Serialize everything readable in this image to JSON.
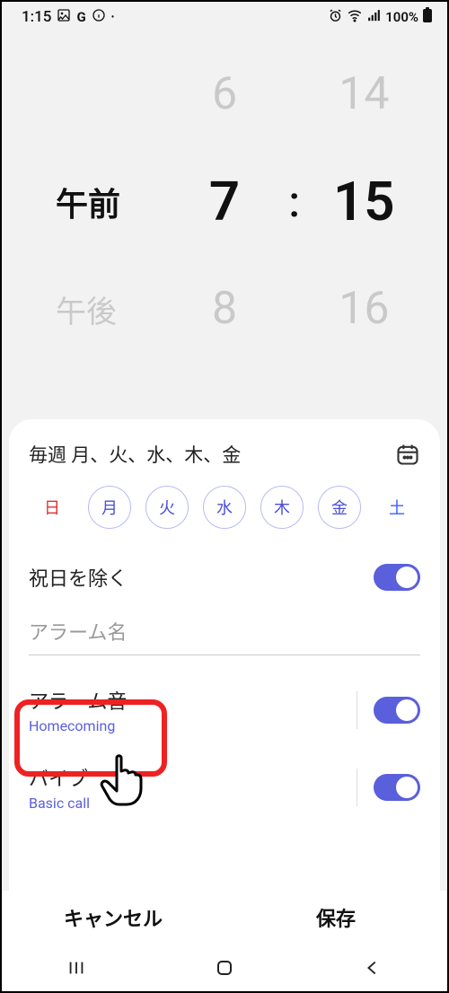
{
  "status": {
    "time": "1:15",
    "battery": "100%"
  },
  "picker": {
    "ampm_selected": "午前",
    "ampm_other": "午後",
    "hour_prev": "6",
    "hour": "7",
    "hour_next": "8",
    "minute_prev": "14",
    "minute": "15",
    "minute_next": "16",
    "colon": ":"
  },
  "schedule": {
    "summary": "毎週 月、火、水、木、金"
  },
  "days": {
    "sun": "日",
    "mon": "月",
    "tue": "火",
    "wed": "水",
    "thu": "木",
    "fri": "金",
    "sat": "土"
  },
  "holiday": {
    "label": "祝日を除く"
  },
  "name": {
    "placeholder": "アラーム名"
  },
  "sound": {
    "label": "アラーム音",
    "value": "Homecoming"
  },
  "vibration": {
    "label": "バイブ",
    "value": "Basic call"
  },
  "buttons": {
    "cancel": "キャンセル",
    "save": "保存"
  }
}
